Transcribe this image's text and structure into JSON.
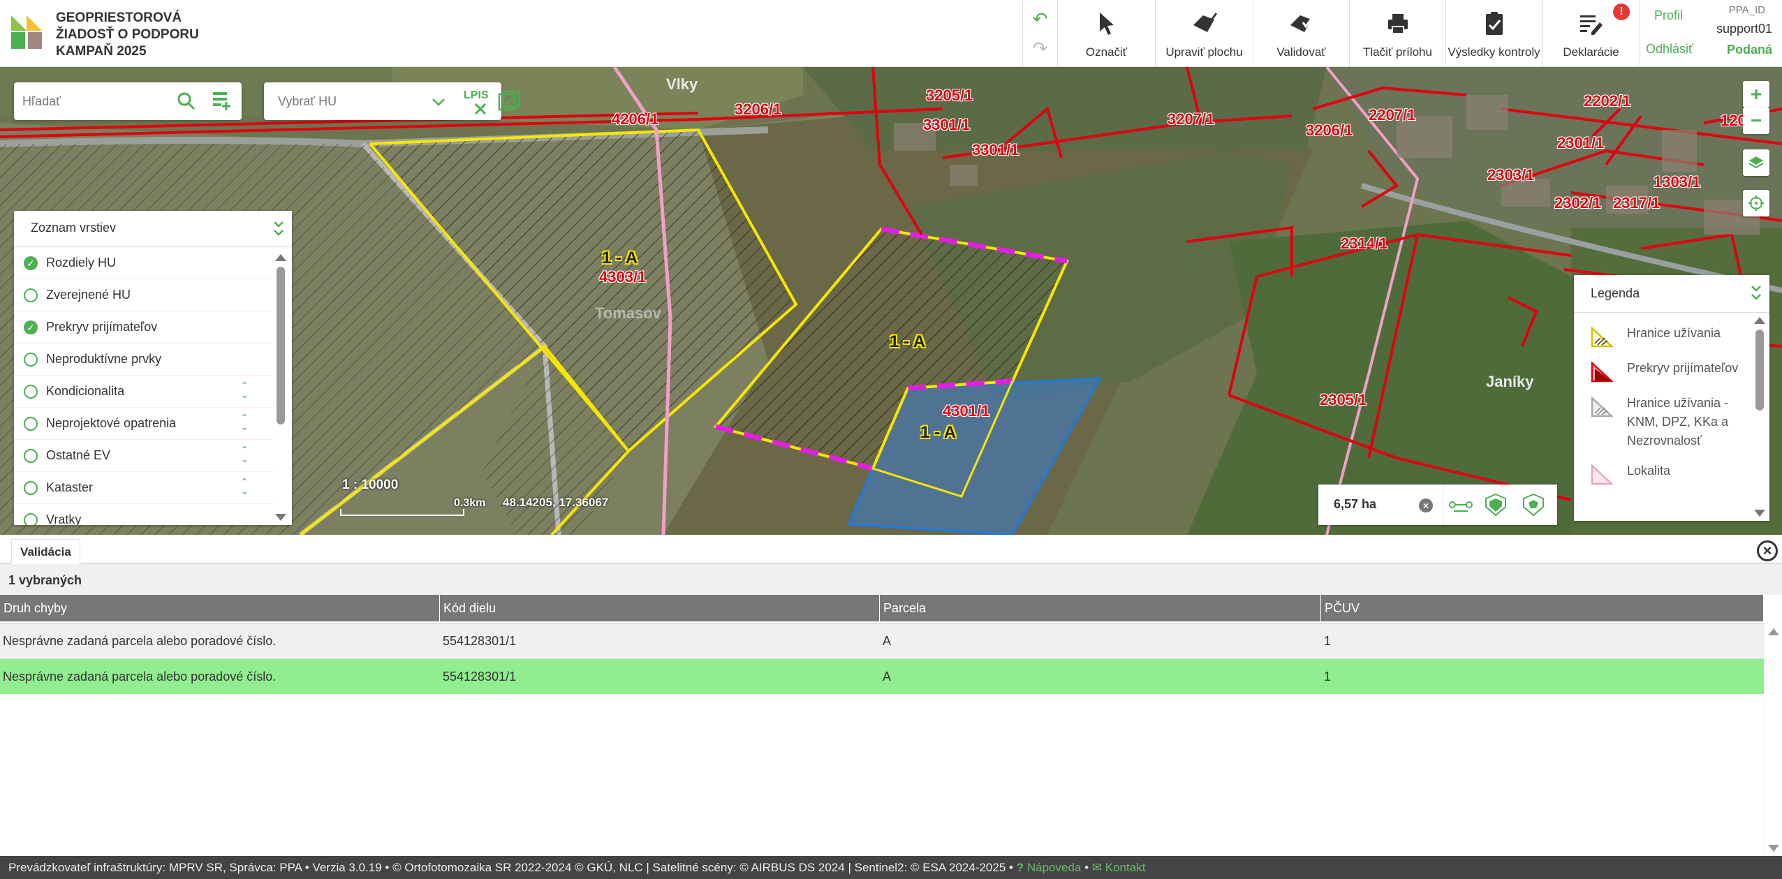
{
  "app": {
    "title_lines": [
      "GEOPRIESTOROVÁ",
      "ŽIADOSŤ O PODPORU",
      "KAMPAŇ 2025"
    ]
  },
  "toolbar": {
    "undo_icon": "undo-arrow-icon",
    "redo_icon": "redo-arrow-icon",
    "select_label": "Označiť",
    "edit_area_label": "Upraviť plochu",
    "validate_label": "Validovať",
    "print_label": "Tlačiť prílohu",
    "results_label": "Výsledky kontroly",
    "declarations_label": "Deklarácie",
    "declarations_badge": "!"
  },
  "user": {
    "profile_label": "Profil",
    "logout_label": "Odhlásiť",
    "ppa_id_label": "PPA_ID",
    "username": "support01",
    "status": "Podaná"
  },
  "search": {
    "placeholder": "Hľadať",
    "hu_placeholder": "Vybrať HU",
    "lpis_label": "LPIS"
  },
  "layers": {
    "title": "Zoznam vrstiev",
    "items": [
      {
        "label": "Rozdiely HU",
        "checked": true
      },
      {
        "label": "Zverejnené HU",
        "checked": false
      },
      {
        "label": "Prekryv prijímateľov",
        "checked": true
      },
      {
        "label": "Neproduktívne prvky",
        "checked": false
      },
      {
        "label": "Kondicionalita",
        "checked": false
      },
      {
        "label": "Neprojektové opatrenia",
        "checked": false
      },
      {
        "label": "Ostatné EV",
        "checked": false
      },
      {
        "label": "Kataster",
        "checked": false
      },
      {
        "label": "Vratky",
        "checked": false
      }
    ]
  },
  "map": {
    "scale": "1 : 10000",
    "scale_bar": "0.3km",
    "coordinates": "48.14205, 17.36067",
    "parcel_labels": [
      "4206/1",
      "3206/1",
      "3205/1",
      "3301/1",
      "3207/1",
      "3206/1",
      "2207/1",
      "2202/1",
      "1202/",
      "2301/1",
      "2303/1",
      "1303/1",
      "2302/1",
      "2317/1",
      "2314/1",
      "2305/1",
      "4303/1",
      "4301/1",
      "3301/1"
    ],
    "block_labels": [
      "1 - A",
      "1 - A",
      "1 - A"
    ],
    "places": [
      "Vlky",
      "Tomasov",
      "Janíky"
    ],
    "area_value": "6,57 ha",
    "colors": {
      "parcel_boundary": "#e00010",
      "usage_boundary": "#f5e700",
      "overlap": "#e020e0",
      "selection_fill": "#3a7bd5",
      "locality": "#f0a0c8"
    }
  },
  "legend": {
    "title": "Legenda",
    "items": [
      {
        "label": "Hranice užívania"
      },
      {
        "label": "Prekryv prijímateľov"
      },
      {
        "label": "Hranice užívania - KNM, DPZ, KKa a Nezrovnalosť"
      },
      {
        "label": "Lokalita"
      }
    ]
  },
  "validation": {
    "tab_label": "Validácia",
    "selected_count": "1 vybraných",
    "columns": [
      "Druh chyby",
      "Kód dielu",
      "Parcela",
      "PČUV"
    ],
    "rows": [
      [
        "Nesprávne zadaná parcela alebo poradové číslo.",
        "554128301/1",
        "A",
        "1"
      ],
      [
        "Nesprávne zadaná parcela alebo poradové číslo.",
        "554128301/1",
        "A",
        "1"
      ]
    ]
  },
  "footer": {
    "text": "Prevádzkovateľ infraštruktúry: MPRV SR, Správca: PPA • Verzia 3.0.19 • © Ortofotomozaika SR 2022-2024 © GKÚ, NLC | Satelitné scény: © AIRBUS DS 2024 | Sentinel2: © ESA 2024-2025 •",
    "help_label": "Nápoveda",
    "contact_label": "Kontakt"
  }
}
